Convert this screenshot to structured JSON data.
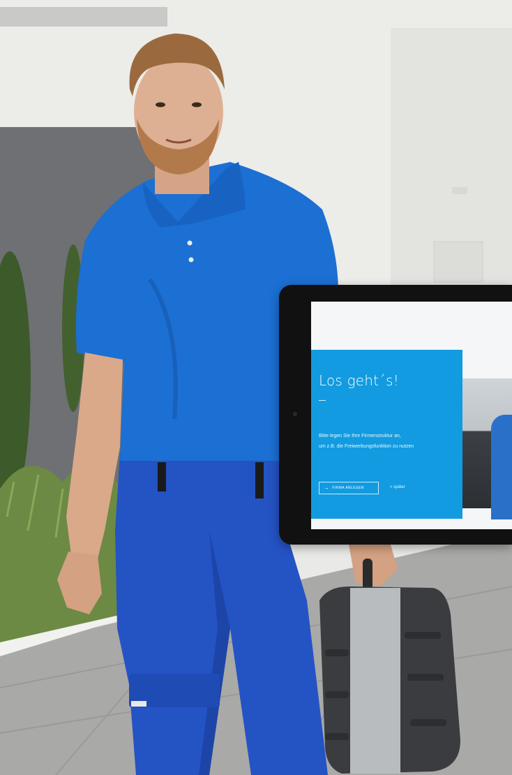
{
  "photo": {
    "subject": "man-in-blue-workwear",
    "icons": [
      "person-icon",
      "tool-case-icon",
      "tablet-icon"
    ]
  },
  "tablet": {
    "screen": {
      "title": "Los geht´s!",
      "body_line1": "Bitte legen Sie Ihre Firmenstruktur an,",
      "body_line2": "um z.B. die Freiwerbungsfunktion zu nutzen",
      "primary_button": "FIRMA ANLEGEN",
      "secondary_link": "> später"
    }
  },
  "colors": {
    "card": "#129be0",
    "shirt": "#1c6fd3",
    "pants": "#2453c4",
    "case": "#3a3c3f"
  }
}
